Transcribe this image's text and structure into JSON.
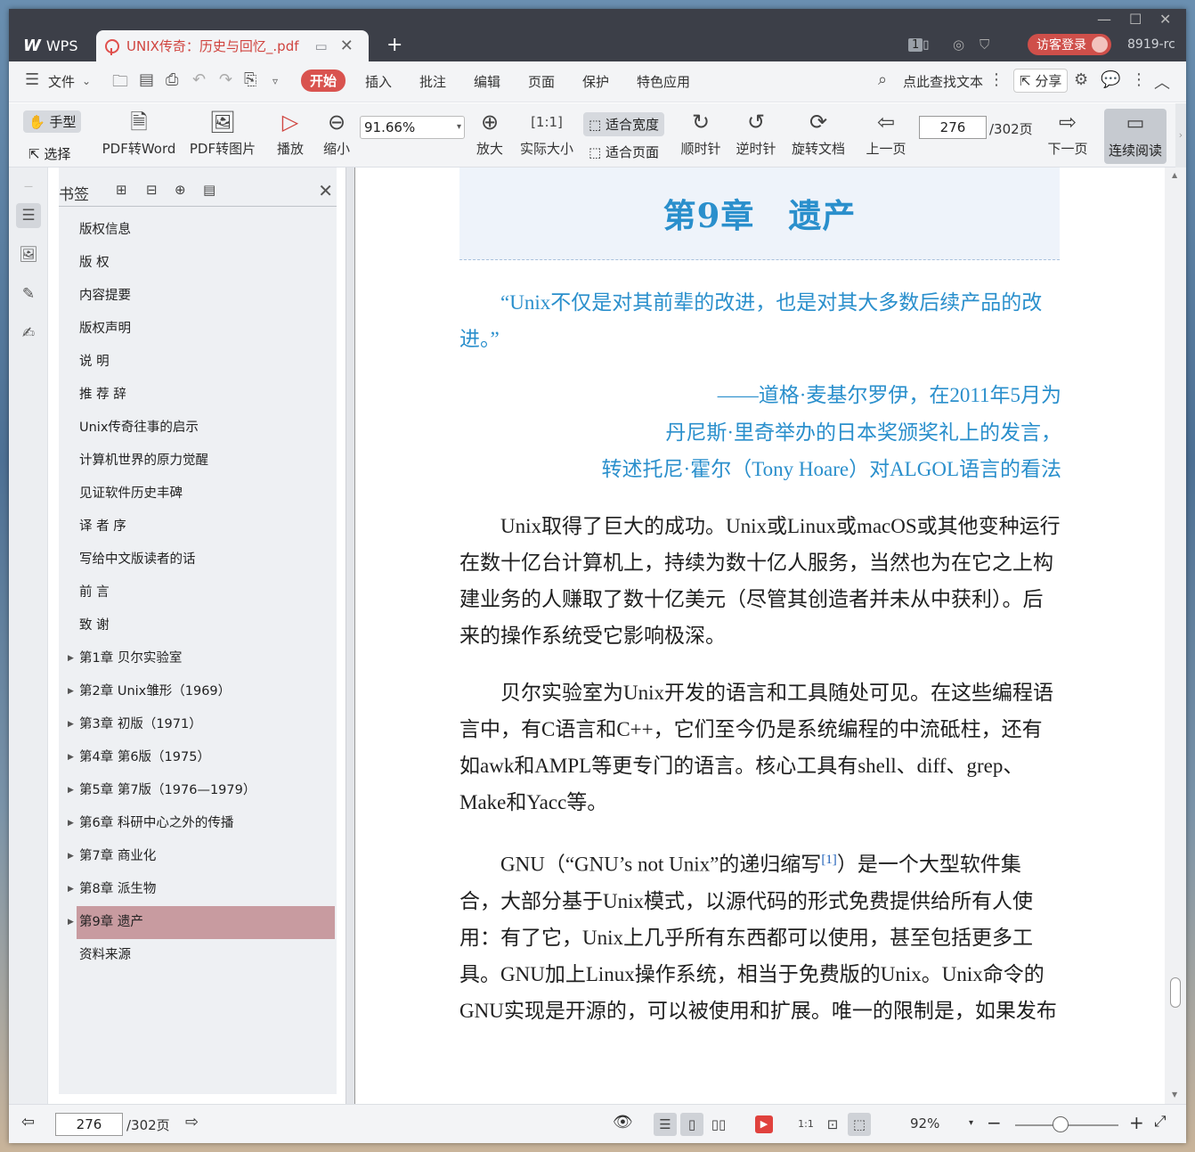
{
  "titlebar": {
    "app_name": "WPS",
    "doc_tab_name": "UNIX传奇：历史与回忆_.pdf",
    "page_badge": "1",
    "login_label": "访客登录",
    "user_id": "8919-rc"
  },
  "menubar": {
    "file_label": "文件",
    "tabs": [
      "开始",
      "插入",
      "批注",
      "编辑",
      "页面",
      "保护",
      "特色应用"
    ],
    "search_label": "点此查找文本",
    "share_label": "分享"
  },
  "ribbon": {
    "hand_label": "手型",
    "select_label": "选择",
    "pdf_to_word": "PDF转Word",
    "pdf_to_image": "PDF转图片",
    "play": "播放",
    "zoom_out": "缩小",
    "zoom_value": "91.66%",
    "zoom_in": "放大",
    "actual_size": "实际大小",
    "fit_width": "适合宽度",
    "fit_page": "适合页面",
    "clockwise": "顺时针",
    "counterclockwise": "逆时针",
    "rotate_doc": "旋转文档",
    "prev_page": "上一页",
    "current_page": "276",
    "total_pages": "/302页",
    "next_page": "下一页",
    "continuous_read": "连续阅读"
  },
  "bookmarks": {
    "title": "书签",
    "items": [
      {
        "label": "版权信息",
        "expandable": false
      },
      {
        "label": "版 权",
        "expandable": false
      },
      {
        "label": "内容提要",
        "expandable": false
      },
      {
        "label": "版权声明",
        "expandable": false
      },
      {
        "label": "说 明",
        "expandable": false
      },
      {
        "label": "推 荐 辞",
        "expandable": false
      },
      {
        "label": "Unix传奇往事的启示",
        "expandable": false
      },
      {
        "label": "计算机世界的原力觉醒",
        "expandable": false
      },
      {
        "label": "见证软件历史丰碑",
        "expandable": false
      },
      {
        "label": "译 者 序",
        "expandable": false
      },
      {
        "label": "写给中文版读者的话",
        "expandable": false
      },
      {
        "label": "前 言",
        "expandable": false
      },
      {
        "label": "致 谢",
        "expandable": false
      },
      {
        "label": "第1章 贝尔实验室",
        "expandable": true
      },
      {
        "label": "第2章 Unix雏形（1969）",
        "expandable": true
      },
      {
        "label": "第3章 初版（1971）",
        "expandable": true
      },
      {
        "label": "第4章 第6版（1975）",
        "expandable": true
      },
      {
        "label": "第5章 第7版（1976—1979）",
        "expandable": true
      },
      {
        "label": "第6章 科研中心之外的传播",
        "expandable": true
      },
      {
        "label": "第7章 商业化",
        "expandable": true
      },
      {
        "label": "第8章 派生物",
        "expandable": true
      },
      {
        "label": "第9章 遗产",
        "expandable": true,
        "selected": true
      },
      {
        "label": "资料来源",
        "expandable": false
      }
    ]
  },
  "document": {
    "chapter_title": "第9章　遗产",
    "quote": "“Unix不仅是对其前辈的改进，也是对其大多数后续产品的改进。”",
    "attribution": [
      "——道格·麦基尔罗伊，在2011年5月为",
      "丹尼斯·里奇举办的日本奖颁奖礼上的发言，",
      "转述托尼·霍尔（Tony Hoare）对ALGOL语言的看法"
    ],
    "paragraphs": [
      "Unix取得了巨大的成功。Unix或Linux或macOS或其他变种运行在数十亿台计算机上，持续为数十亿人服务，当然也为在它之上构建业务的人赚取了数十亿美元（尽管其创造者并未从中获利）。后来的操作系统受它影响极深。",
      "贝尔实验室为Unix开发的语言和工具随处可见。在这些编程语言中，有C语言和C++，它们至今仍是系统编程的中流砥柱，还有如awk和AMPL等更专门的语言。核心工具有shell、diff、grep、Make和Yacc等。"
    ],
    "para3_before": "GNU（“GNU’s not Unix”的递归缩写",
    "para3_footnote": "[1]",
    "para3_after": "）是一个大型软件集合，大部分基于Unix模式，以源代码的形式免费提供给所有人使用：有了它，Unix上几乎所有东西都可以使用，甚至包括更多工具。GNU加上Linux操作系统，相当于免费版的Unix。Unix命令的GNU实现是开源的，可以被使用和扩展。唯一的限制是，如果发布"
  },
  "statusbar": {
    "current_page": "276",
    "total_pages": "/302页",
    "zoom_percent": "92%"
  },
  "colors": {
    "accent_red": "#d9534f",
    "chapter_blue": "#2a8fcc",
    "selected_bookmark": "#c89ba0"
  }
}
